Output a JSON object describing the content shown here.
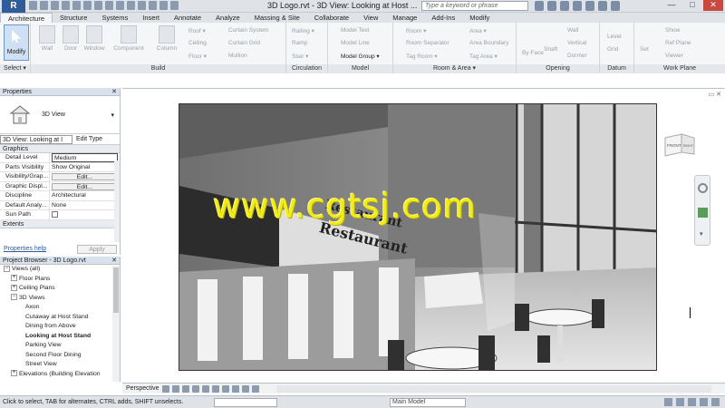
{
  "titlebar": {
    "app_letter": "R",
    "title": "3D Logo.rvt - 3D View: Looking at Host ...",
    "search_placeholder": "Type a keyword or phrase",
    "window_controls": [
      "—",
      "□",
      "✕"
    ]
  },
  "tabs": [
    "Architecture",
    "Structure",
    "Systems",
    "Insert",
    "Annotate",
    "Analyze",
    "Massing & Site",
    "Collaborate",
    "View",
    "Manage",
    "Add-Ins",
    "Modify"
  ],
  "ribbon": {
    "modify": "Modify",
    "select_panel": "Select ▾",
    "build_tools": [
      "Wall",
      "Door",
      "Window",
      "Component",
      "Column"
    ],
    "build_small": [
      "Roof ▾",
      "Ceiling",
      "Floor ▾",
      "Curtain System",
      "Curtain Grid",
      "Mullion"
    ],
    "circulation_tools": [
      "Railing ▾",
      "Ramp",
      "Stair ▾"
    ],
    "model_tools": [
      "Model Text",
      "Model Line",
      "Model Group ▾"
    ],
    "room_tools": [
      "Room ▾",
      "Room Separator",
      "Tag Room ▾",
      "Area ▾",
      "Area Boundary",
      "Tag Area ▾"
    ],
    "opening_tools": [
      "By Face",
      "Shaft",
      "Wall",
      "Vertical",
      "Dormer"
    ],
    "datum_tools": [
      "Level",
      "Grid"
    ],
    "workplane_tools": [
      "Set",
      "Show",
      "Ref Plane",
      "Viewer"
    ],
    "panel_titles": [
      "Build",
      "Circulation",
      "Model",
      "Room & Area ▾",
      "Opening",
      "Datum",
      "Work Plane"
    ]
  },
  "properties": {
    "header": "Properties",
    "type_name": "3D View",
    "view_selector": "3D View: Looking at I",
    "edit_type": "Edit Type",
    "graphics_section": "Graphics",
    "rows": [
      {
        "k": "Detail Level",
        "v": "Medium"
      },
      {
        "k": "Parts Visibility",
        "v": "Show Original"
      },
      {
        "k": "Visibility/Grap...",
        "v": "Edit..."
      },
      {
        "k": "Graphic Displ...",
        "v": "Edit..."
      },
      {
        "k": "Discipline",
        "v": "Architectural"
      },
      {
        "k": "Default Analy...",
        "v": "None"
      },
      {
        "k": "Sun Path",
        "v": ""
      }
    ],
    "extents_section": "Extents",
    "help_link": "Properties help",
    "apply": "Apply"
  },
  "project_browser": {
    "header": "Project Browser - 3D Logo.rvt",
    "items": [
      {
        "label": "Views (all)",
        "indent": 0,
        "toggle": "−"
      },
      {
        "label": "Floor Plans",
        "indent": 1,
        "toggle": "+"
      },
      {
        "label": "Ceiling Plans",
        "indent": 1,
        "toggle": "+"
      },
      {
        "label": "3D Views",
        "indent": 1,
        "toggle": "−"
      },
      {
        "label": "Axon",
        "indent": 3,
        "toggle": ""
      },
      {
        "label": "Cutaway at Host Stand",
        "indent": 3,
        "toggle": ""
      },
      {
        "label": "Dining from Above",
        "indent": 3,
        "toggle": ""
      },
      {
        "label": "Looking at Host Stand",
        "indent": 3,
        "toggle": "",
        "bold": true
      },
      {
        "label": "Parking View",
        "indent": 3,
        "toggle": ""
      },
      {
        "label": "Second Floor Dining",
        "indent": 3,
        "toggle": ""
      },
      {
        "label": "Street View",
        "indent": 3,
        "toggle": ""
      },
      {
        "label": "Elevations (Building Elevation",
        "indent": 1,
        "toggle": "+"
      }
    ]
  },
  "viewport": {
    "view_controls": "▭ ✕",
    "viewcube_front": "FRONT",
    "viewcube_right": "RIGHT",
    "sign_line1": "Restaurant",
    "sign_line2": "Restaurant",
    "watermark": "www.cgtsj.com"
  },
  "viewbar": {
    "perspective": "Perspective"
  },
  "statusbar": {
    "message": "Click to select, TAB for alternates, CTRL adds, SHIFT unselects.",
    "model": "Main Model"
  },
  "colors": {
    "accent": "#2e5d9a",
    "watermark": "#f1ec18",
    "ribbon_bg": "#f4f6f8"
  }
}
